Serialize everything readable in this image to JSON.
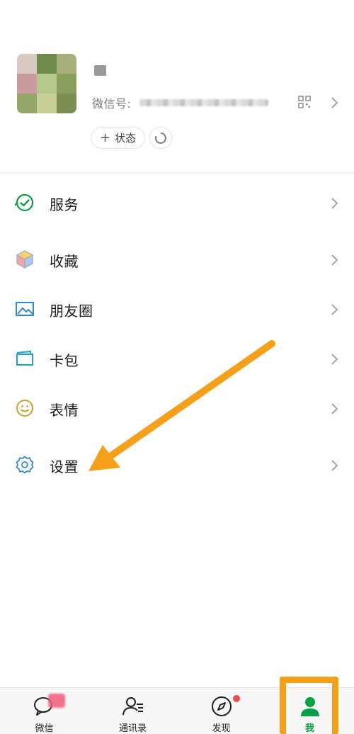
{
  "profile": {
    "wechat_id_label": "微信号:",
    "status_button_plus": "+",
    "status_button_label": "状态"
  },
  "menu": {
    "items": [
      {
        "key": "services",
        "label": "服务",
        "icon": "services-icon"
      },
      {
        "key": "favorites",
        "label": "收藏",
        "icon": "favorites-cube-icon"
      },
      {
        "key": "moments",
        "label": "朋友圈",
        "icon": "moments-photo-icon"
      },
      {
        "key": "cards",
        "label": "卡包",
        "icon": "card-wallet-icon"
      },
      {
        "key": "stickers",
        "label": "表情",
        "icon": "smiley-icon"
      },
      {
        "key": "settings",
        "label": "设置",
        "icon": "gear-icon"
      }
    ]
  },
  "tabbar": {
    "tabs": [
      {
        "key": "chats",
        "label": "微信",
        "icon": "chat-bubble-icon"
      },
      {
        "key": "contacts",
        "label": "通讯录",
        "icon": "contacts-icon"
      },
      {
        "key": "discover",
        "label": "发现",
        "icon": "compass-icon"
      },
      {
        "key": "me",
        "label": "我",
        "icon": "person-icon",
        "active": true
      }
    ]
  },
  "colors": {
    "wechat_green": "#07a044",
    "annotation_orange": "#f6a01a",
    "badge_red": "#f24848",
    "services_icon": "#07a044",
    "moments_icon": "#2f8bcf",
    "cards_icon": "#1aa6c9",
    "stickers_icon": "#c9a520",
    "settings_icon": "#2f8bcf"
  }
}
